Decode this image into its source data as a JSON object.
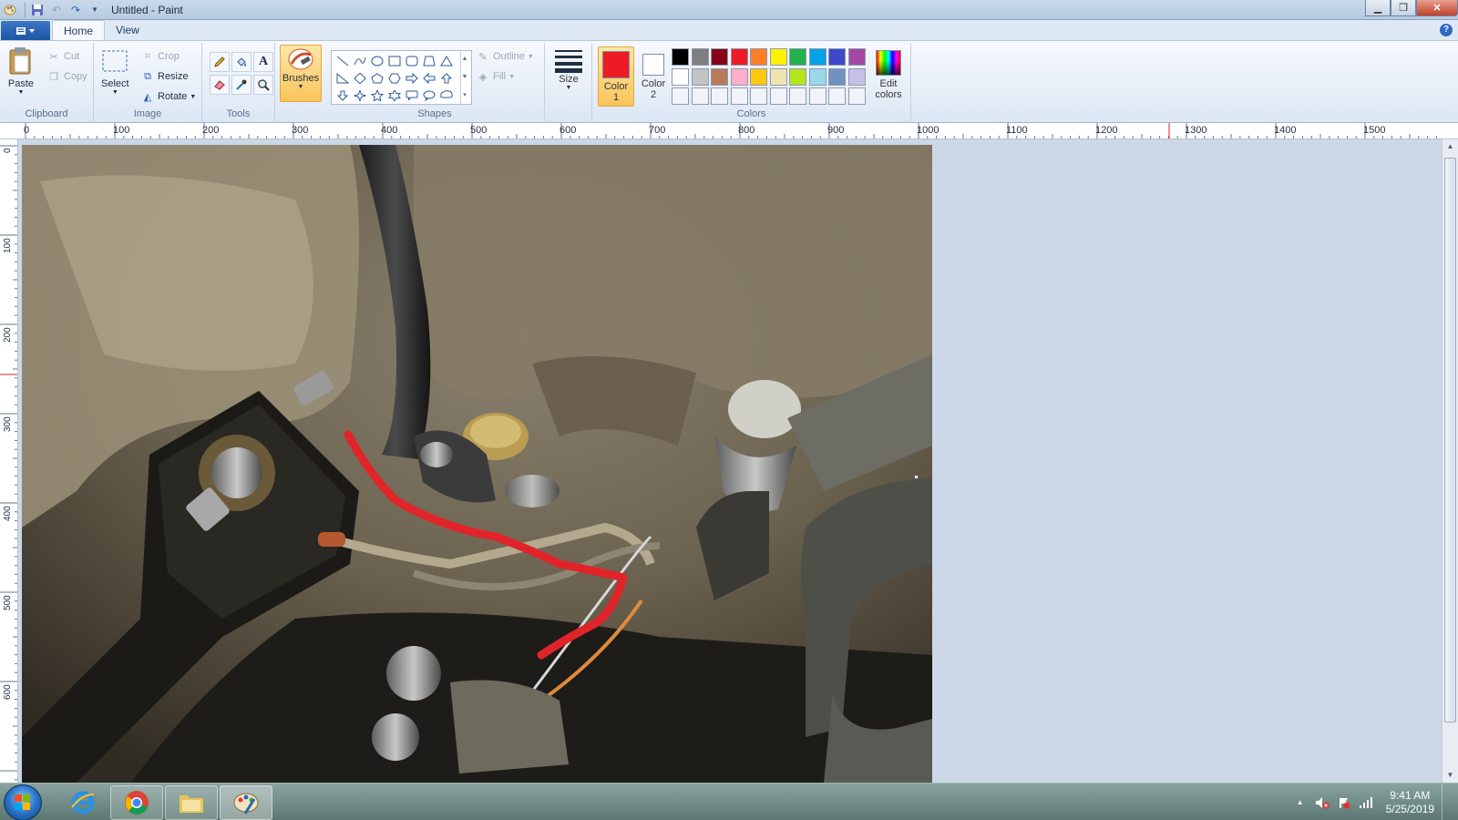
{
  "window": {
    "title": "Untitled - Paint"
  },
  "tabs": [
    {
      "label": "Home",
      "active": true
    },
    {
      "label": "View",
      "active": false
    }
  ],
  "clipboard": {
    "paste": "Paste",
    "cut": "Cut",
    "copy": "Copy",
    "group": "Clipboard"
  },
  "image": {
    "select": "Select",
    "crop": "Crop",
    "resize": "Resize",
    "rotate": "Rotate",
    "group": "Image"
  },
  "tools": {
    "group": "Tools",
    "items": [
      "pencil-icon",
      "fill-icon",
      "text-icon",
      "eraser-icon",
      "color-picker-icon",
      "magnifier-icon"
    ]
  },
  "brushes": {
    "label": "Brushes"
  },
  "shapes": {
    "group": "Shapes",
    "outline": "Outline",
    "fill": "Fill"
  },
  "size": {
    "label": "Size"
  },
  "colors": {
    "group": "Colors",
    "color1": {
      "label1": "Color",
      "label2": "1",
      "value": "#ed1c24"
    },
    "color2": {
      "label1": "Color",
      "label2": "2",
      "value": "#ffffff"
    },
    "edit": {
      "label1": "Edit",
      "label2": "colors"
    },
    "palette_row1": [
      "#000000",
      "#7f7f7f",
      "#880015",
      "#ed1c24",
      "#ff7f27",
      "#fff200",
      "#22b14c",
      "#00a2e8",
      "#3f48cc",
      "#a349a4"
    ],
    "palette_row2": [
      "#ffffff",
      "#c3c3c3",
      "#b97a57",
      "#ffaec9",
      "#ffc90e",
      "#efe4b0",
      "#b5e61d",
      "#99d9ea",
      "#7092be",
      "#c8bfe7"
    ],
    "palette_row3": [
      "#f0f3f8",
      "#f0f3f8",
      "#f0f3f8",
      "#f0f3f8",
      "#f0f3f8",
      "#f0f3f8",
      "#f0f3f8",
      "#f0f3f8",
      "#f0f3f8",
      "#f0f3f8"
    ]
  },
  "ruler": {
    "h_labels": [
      "0",
      "100",
      "200",
      "300",
      "400",
      "500",
      "600",
      "700",
      "800",
      "900",
      "1000",
      "1100",
      "1200",
      "1300",
      "1400",
      "1500"
    ],
    "v_labels": [
      "0",
      "100",
      "200",
      "300",
      "400",
      "500",
      "600"
    ]
  },
  "taskbar": {
    "time": "9:41 AM",
    "date": "5/25/2019"
  }
}
